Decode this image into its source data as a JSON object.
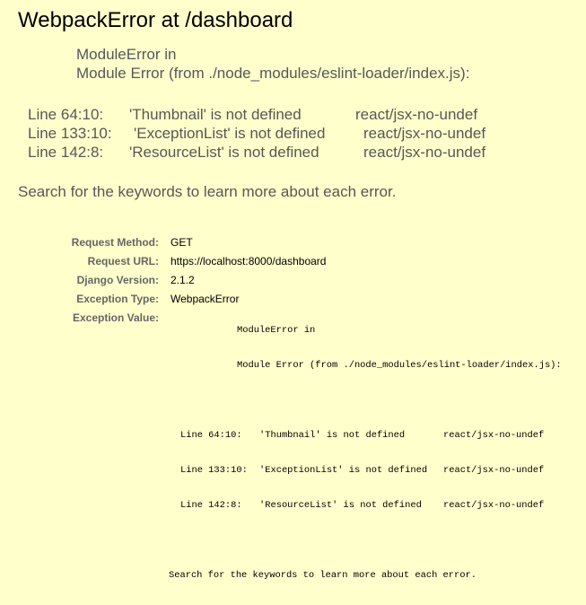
{
  "summary": {
    "title": "WebpackError at /dashboard",
    "exception_message": [
      "ModuleError in",
      "Module Error (from ./node_modules/eslint-loader/index.js):"
    ],
    "errors": [
      {
        "location": "Line 64:10:",
        "message": "'Thumbnail' is not defined",
        "rule": "react/jsx-no-undef"
      },
      {
        "location": "Line 133:10:",
        "message": "'ExceptionList' is not defined",
        "rule": "react/jsx-no-undef"
      },
      {
        "location": "Line 142:8:",
        "message": "'ResourceList' is not defined",
        "rule": "react/jsx-no-undef"
      }
    ],
    "hint": "Search for the keywords to learn more about each error."
  },
  "meta": {
    "rows": [
      {
        "label": "Request Method:",
        "value": "GET"
      },
      {
        "label": "Request URL:",
        "value": "https://localhost:8000/dashboard"
      },
      {
        "label": "Django Version:",
        "value": "2.1.2"
      },
      {
        "label": "Exception Type:",
        "value": "WebpackError"
      },
      {
        "label": "Exception Value:",
        "value": ""
      }
    ]
  },
  "exception_value": {
    "message": [
      "ModuleError in",
      "Module Error (from ./node_modules/eslint-loader/index.js):"
    ],
    "errors": [
      {
        "location": "Line 64:10:",
        "message": "'Thumbnail' is not defined",
        "rule": "react/jsx-no-undef"
      },
      {
        "location": "Line 133:10:",
        "message": "'ExceptionList' is not defined",
        "rule": "react/jsx-no-undef"
      },
      {
        "location": "Line 142:8:",
        "message": "'ResourceList' is not defined",
        "rule": "react/jsx-no-undef"
      }
    ],
    "hint": "Search for the keywords to learn more about each error."
  },
  "colors": {
    "background": "#ffffcc",
    "muted_text": "#575757",
    "label_text": "#666666"
  }
}
